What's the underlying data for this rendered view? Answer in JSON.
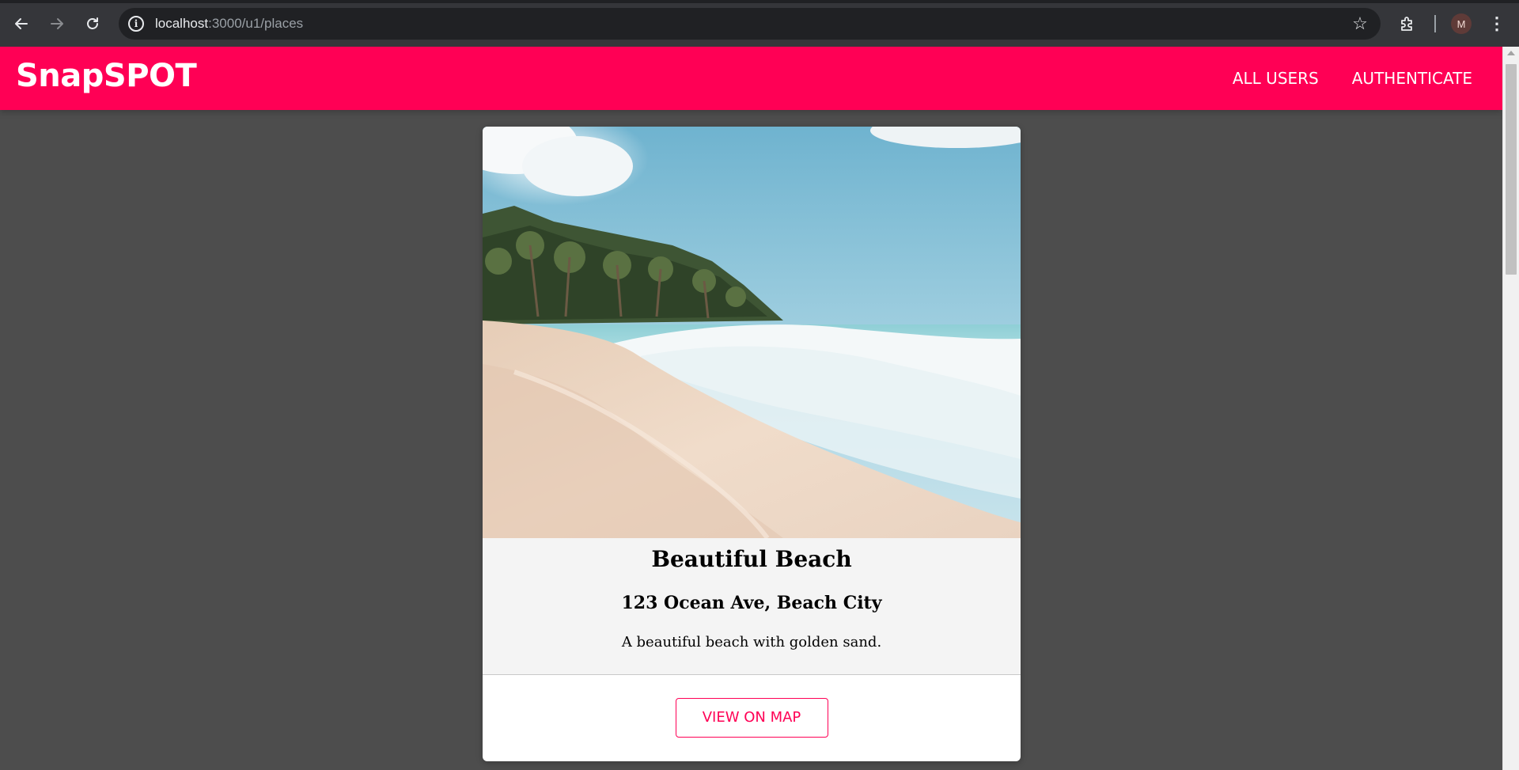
{
  "browser": {
    "url_host": "localhost",
    "url_rest": ":3000/u1/places",
    "profile_initial": "M",
    "icons": {
      "back": "arrow-left-icon",
      "forward": "arrow-right-icon",
      "reload": "reload-icon",
      "site_info": "info-icon",
      "bookmark": "star-icon",
      "extensions": "puzzle-icon",
      "menu": "kebab-menu-icon"
    }
  },
  "app": {
    "brand": "SnapSPOT",
    "nav": {
      "all_users": "ALL USERS",
      "authenticate": "AUTHENTICATE"
    },
    "colors": {
      "accent": "#ff0055",
      "page_bg": "#4d4d4d",
      "card_info_bg": "#f4f4f4"
    }
  },
  "place": {
    "title": "Beautiful Beach",
    "address": "123 Ocean Ave, Beach City",
    "description": "A beautiful beach with golden sand.",
    "view_on_map_label": "VIEW ON MAP"
  }
}
